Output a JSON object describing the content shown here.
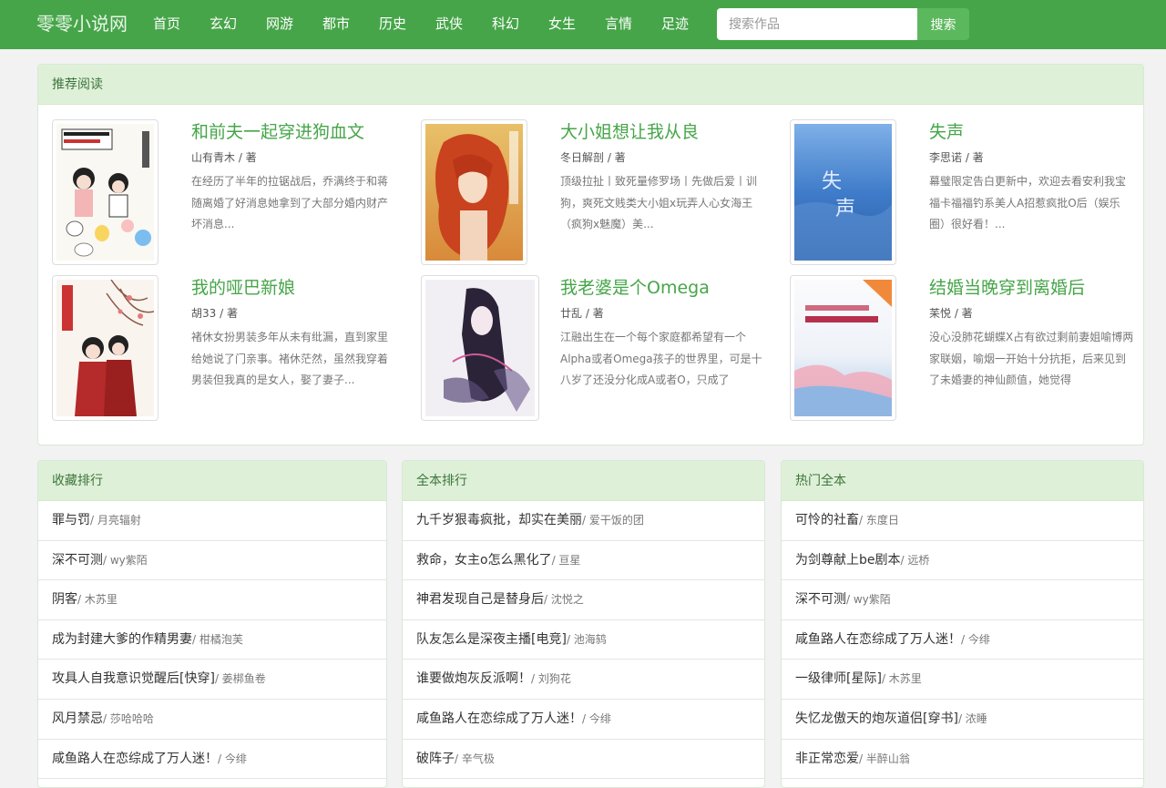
{
  "nav": {
    "brand": "零零小说网",
    "menu": [
      "首页",
      "玄幻",
      "网游",
      "都市",
      "历史",
      "武侠",
      "科幻",
      "女生",
      "言情",
      "足迹"
    ],
    "search_placeholder": "搜索作品",
    "search_button": "搜索"
  },
  "recommend": {
    "title": "推荐阅读",
    "books": [
      {
        "title": "和前夫一起穿进狗血文",
        "author": "山有青木 / 著",
        "desc": "在经历了半年的拉锯战后，乔满终于和蒋随离婚了好消息她拿到了大部分婚内财产坏消息..."
      },
      {
        "title": "大小姐想让我从良",
        "author": "冬日解剖 / 著",
        "desc": "顶级拉扯丨致死量修罗场丨先做后爱丨训狗，爽死文贱类大小姐x玩弄人心女海王（疯狗x魅魔）美..."
      },
      {
        "title": "失声",
        "author": "李思诺 / 著",
        "desc": "幕璧限定告白更新中，欢迎去看安利我宝福卡福福钓系美人A招惹疯批O后（娱乐圈）很好看！..."
      },
      {
        "title": "我的哑巴新娘",
        "author": "胡33 / 著",
        "desc": "褚休女扮男装多年从未有纰漏，直到家里给她说了门亲事。褚休茫然，虽然我穿着男装但我真的是女人，娶了妻子..."
      },
      {
        "title": "我老婆是个Omega",
        "author": "廿乱 / 著",
        "desc": "江融出生在一个每个家庭都希望有一个Alpha或者Omega孩子的世界里，可是十八岁了还没分化成A或者O，只成了"
      },
      {
        "title": "结婚当晚穿到离婚后",
        "author": "苿悦 / 著",
        "desc": "没心没肺花蝴蝶X占有欲过剩前妻姐喻博两家联姻，喻烟一开始十分抗拒，后来见到了未婚妻的神仙颜值，她觉得"
      }
    ]
  },
  "lists": [
    {
      "title": "收藏排行",
      "items": [
        {
          "title": "罪与罚",
          "author": "/ 月亮辐射"
        },
        {
          "title": "深不可测",
          "author": "/ wy紫陌"
        },
        {
          "title": "阴客",
          "author": "/ 木苏里"
        },
        {
          "title": "成为封建大爹的作精男妻",
          "author": "/ 柑橘泡芙"
        },
        {
          "title": "攻具人自我意识觉醒后[快穿]",
          "author": "/ 姜梆鱼卷"
        },
        {
          "title": "风月禁忌",
          "author": "/ 莎哈哈哈"
        },
        {
          "title": "咸鱼路人在恋综成了万人迷！",
          "author": "/ 今绯"
        }
      ]
    },
    {
      "title": "全本排行",
      "items": [
        {
          "title": "九千岁狠毒疯批，却实在美丽",
          "author": "/ 爱干饭的团"
        },
        {
          "title": "救命，女主o怎么黑化了",
          "author": "/ 亘星"
        },
        {
          "title": "神君发现自己是替身后",
          "author": "/ 沈悦之"
        },
        {
          "title": "队友怎么是深夜主播[电竞]",
          "author": "/ 池海鸫"
        },
        {
          "title": "谁要做炮灰反派啊！",
          "author": "/ 刘狗花"
        },
        {
          "title": "咸鱼路人在恋综成了万人迷！",
          "author": "/ 今绯"
        },
        {
          "title": "破阵子",
          "author": "/ 辛气极"
        }
      ]
    },
    {
      "title": "热门全本",
      "items": [
        {
          "title": "可怜的社畜",
          "author": "/ 东度日"
        },
        {
          "title": "为剑尊献上be剧本",
          "author": "/ 远桥"
        },
        {
          "title": "深不可测",
          "author": "/ wy紫陌"
        },
        {
          "title": "咸鱼路人在恋综成了万人迷！",
          "author": "/ 今绯"
        },
        {
          "title": "一级律师[星际]",
          "author": "/ 木苏里"
        },
        {
          "title": "失忆龙傲天的炮灰道侣[穿书]",
          "author": "/ 浓睡"
        },
        {
          "title": "非正常恋爱",
          "author": "/ 半醉山翁"
        }
      ]
    }
  ]
}
